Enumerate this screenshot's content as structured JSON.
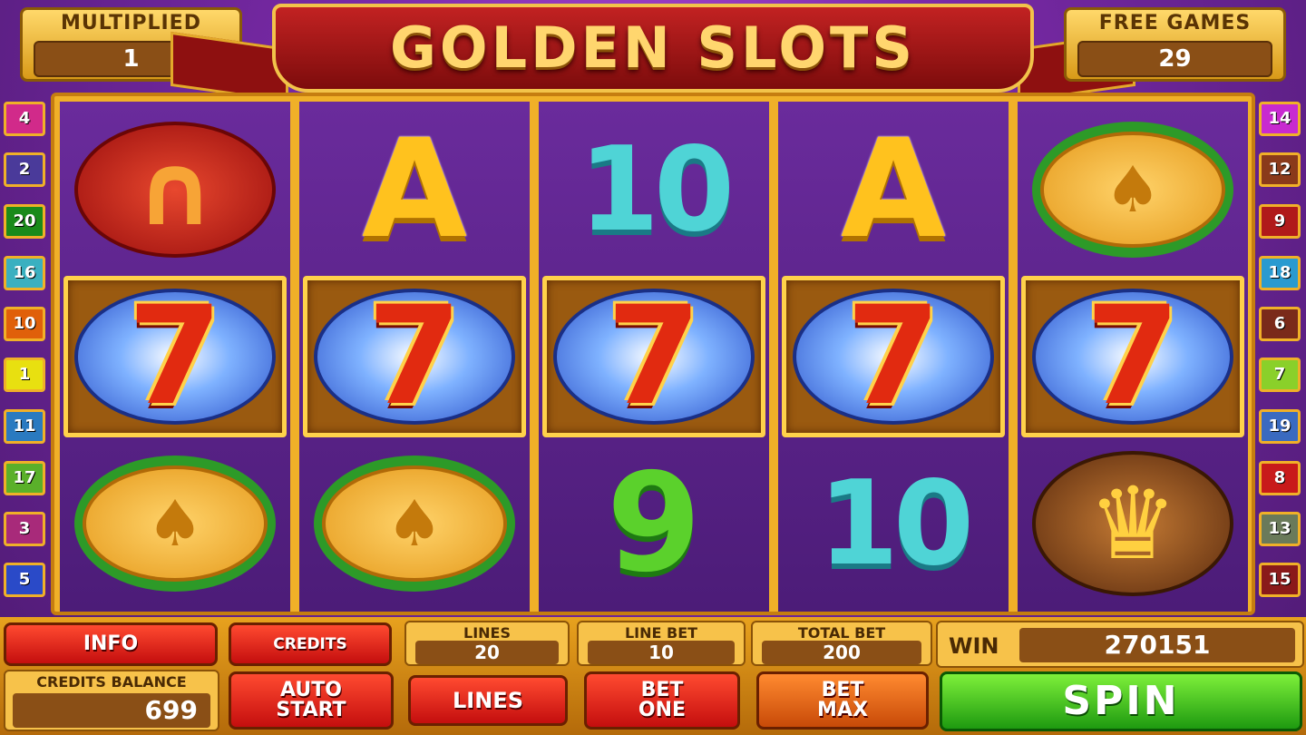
{
  "header": {
    "title": "GOLDEN SLOTS",
    "multiplied_label": "MULTIPLIED",
    "multiplied_value": "1",
    "free_games_label": "FREE GAMES",
    "free_games_value": "29"
  },
  "paylines": {
    "left": [
      "4",
      "2",
      "20",
      "16",
      "10",
      "1",
      "11",
      "17",
      "3",
      "5"
    ],
    "right": [
      "14",
      "12",
      "9",
      "18",
      "6",
      "7",
      "19",
      "8",
      "13",
      "15"
    ],
    "left_colors": [
      "#d12a8a",
      "#4a3a9a",
      "#1a8a1a",
      "#3ab0c0",
      "#e0600a",
      "#e8e010",
      "#2a7ac0",
      "#5ab02a",
      "#a82a7a",
      "#2a4ac8"
    ],
    "right_colors": [
      "#c82ad0",
      "#8a3a1a",
      "#b01a1a",
      "#2a9ad0",
      "#7a2a1a",
      "#8ad02a",
      "#3a6ac0",
      "#c81a1a",
      "#6a7a5a",
      "#8a1a1a"
    ]
  },
  "reels": [
    [
      "horseshoe",
      "seven",
      "spade-coin"
    ],
    [
      "A",
      "seven",
      "spade-coin"
    ],
    [
      "10",
      "seven",
      "9"
    ],
    [
      "A",
      "seven",
      "10"
    ],
    [
      "spade-coin",
      "seven",
      "crown"
    ]
  ],
  "panel": {
    "info_label": "INFO",
    "credits_label": "CREDITS",
    "lines_label": "LINES",
    "lines_value": "20",
    "line_bet_label": "LINE BET",
    "line_bet_value": "10",
    "total_bet_label": "TOTAL BET",
    "total_bet_value": "200",
    "win_label": "WIN",
    "win_value": "270151",
    "credits_balance_label": "CREDITS BALANCE",
    "credits_balance_value": "699",
    "auto_start_line1": "AUTO",
    "auto_start_line2": "START",
    "lines_button_label": "LINES",
    "bet_one_line1": "BET",
    "bet_one_line2": "ONE",
    "bet_max_line1": "BET",
    "bet_max_line2": "MAX",
    "spin_label": "SPIN"
  }
}
